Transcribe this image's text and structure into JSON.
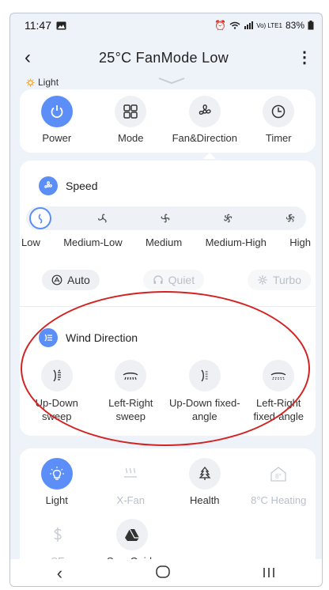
{
  "status": {
    "time": "11:47",
    "battery": "83%",
    "net": "Vo) LTE1"
  },
  "appbar": {
    "title": "25°C FanMode Low"
  },
  "light_indicator": "Light",
  "top_tabs": [
    {
      "label": "Power",
      "icon": "power-icon"
    },
    {
      "label": "Mode",
      "icon": "grid-icon"
    },
    {
      "label": "Fan&Direction",
      "icon": "fan-icon"
    },
    {
      "label": "Timer",
      "icon": "clock-icon"
    }
  ],
  "speed": {
    "title": "Speed",
    "levels": [
      "Low",
      "Medium-Low",
      "Medium",
      "Medium-High",
      "High"
    ],
    "selected": "Low"
  },
  "modes": [
    {
      "label": "Auto",
      "enabled": true
    },
    {
      "label": "Quiet",
      "enabled": false
    },
    {
      "label": "Turbo",
      "enabled": false
    }
  ],
  "wind": {
    "title": "Wind Direction",
    "options": [
      {
        "line1": "Up-Down",
        "line2": "sweep"
      },
      {
        "line1": "Left-Right",
        "line2": "sweep"
      },
      {
        "line1": "Up-Down fixed-",
        "line2": "angle"
      },
      {
        "line1": "Left-Right",
        "line2": "fixed-angle"
      }
    ]
  },
  "functions": [
    {
      "label": "Light",
      "enabled": true,
      "active": true
    },
    {
      "label": "X-Fan",
      "enabled": false
    },
    {
      "label": "Health",
      "enabled": true
    },
    {
      "label": "8°C Heating",
      "enabled": false,
      "badge": "8°"
    }
  ],
  "functions2": [
    {
      "label": "SE",
      "enabled": false
    },
    {
      "label": "SaveGuide",
      "enabled": true
    }
  ],
  "colors": {
    "accent": "#5b8ef7",
    "annotation": "#d42222"
  }
}
